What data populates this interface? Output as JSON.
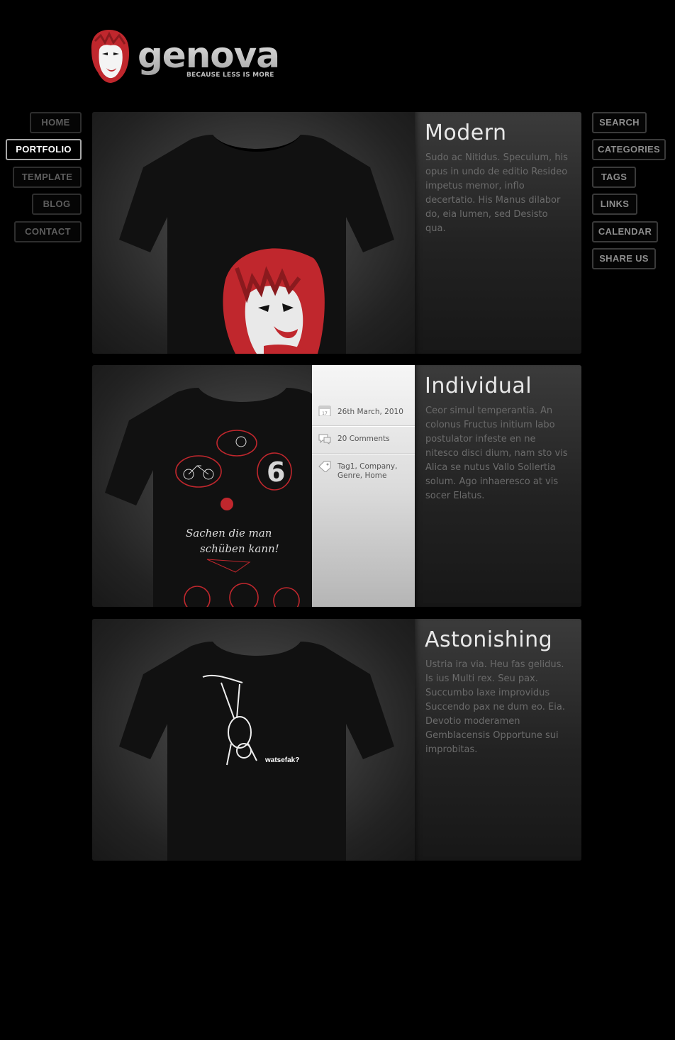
{
  "brand": {
    "name": "genova",
    "tagline": "BECAUSE LESS IS MORE"
  },
  "nav_left": [
    {
      "label": "HOME",
      "active": false
    },
    {
      "label": "PORTFOLIO",
      "active": true
    },
    {
      "label": "TEMPLATE",
      "active": false
    },
    {
      "label": "BLOG",
      "active": false
    },
    {
      "label": "CONTACT",
      "active": false
    }
  ],
  "nav_right": [
    {
      "label": "SEARCH"
    },
    {
      "label": "CATEGORIES"
    },
    {
      "label": "TAGS"
    },
    {
      "label": "LINKS"
    },
    {
      "label": "CALENDAR"
    },
    {
      "label": "SHARE US"
    }
  ],
  "posts": [
    {
      "title": "Modern",
      "body": "Sudo ac Nitidus. Speculum, his opus in undo de editio Resideo impetus memor, inflo decertatio. His Manus dilabor do, eia lumen, sed Desisto qua."
    },
    {
      "title": "Individual",
      "body": "Ceor simul temperantia. An colonus Fructus initium labo postulator infeste en ne nitesco disci dium, nam sto vis Alica se nutus Vallo Sollertia solum. Ago inhaeresco at vis socer Elatus.",
      "meta": {
        "date": "26th March, 2010",
        "calendar_day": "17",
        "comments": "20 Comments",
        "tags": "Tag1, Company, Genre, Home"
      },
      "shirt_text": {
        "number": "6",
        "line1": "Sachen die man",
        "line2": "schüben kann!"
      }
    },
    {
      "title": "Astonishing",
      "body": "Ustria ira via. Heu fas gelidus. Is ius Multi rex. Seu pax. Succumbo laxe improvidus Succendo pax ne dum eo. Eia. Devotio moderamen Gemblacensis Opportune sui improbitas.",
      "shirt_text": {
        "caption": "watsefak?"
      }
    }
  ],
  "colors": {
    "accent_red": "#c0272d",
    "background": "#000000"
  }
}
